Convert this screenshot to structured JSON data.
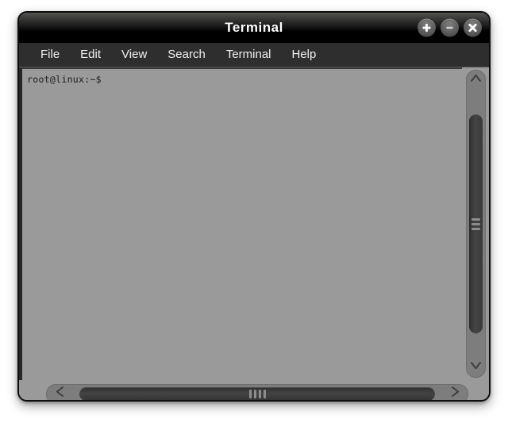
{
  "window": {
    "title": "Terminal",
    "controls": [
      {
        "name": "maximize",
        "label": "+",
        "icon": "plus-icon"
      },
      {
        "name": "minimize",
        "label": "−",
        "icon": "minus-icon"
      },
      {
        "name": "close",
        "label": "×",
        "icon": "close-icon"
      }
    ]
  },
  "menubar": {
    "items": [
      {
        "label": "File"
      },
      {
        "label": "Edit"
      },
      {
        "label": "View"
      },
      {
        "label": "Search"
      },
      {
        "label": "Terminal"
      },
      {
        "label": "Help"
      }
    ]
  },
  "terminal": {
    "prompt": "root@linux:~$",
    "lines": [
      "root@linux:~$"
    ],
    "background_color": "#9a9a9a",
    "text_color": "#1b1b1b"
  },
  "scrollbars": {
    "vertical": {
      "up_arrow_icon": "chevron-up-icon",
      "down_arrow_icon": "chevron-down-icon",
      "grip_count": 3
    },
    "horizontal": {
      "left_arrow_icon": "chevron-left-icon",
      "right_arrow_icon": "chevron-right-icon",
      "grip_count": 4
    }
  },
  "colors": {
    "titlebar_top": "#53534f",
    "titlebar_bottom": "#000000",
    "menubar": "#2e2e2e",
    "terminal_bg": "#9a9a9a",
    "scroll_track": "#7d7d7d",
    "scroll_thumb": "#3a3a3a",
    "desktop": "#ffffff"
  }
}
